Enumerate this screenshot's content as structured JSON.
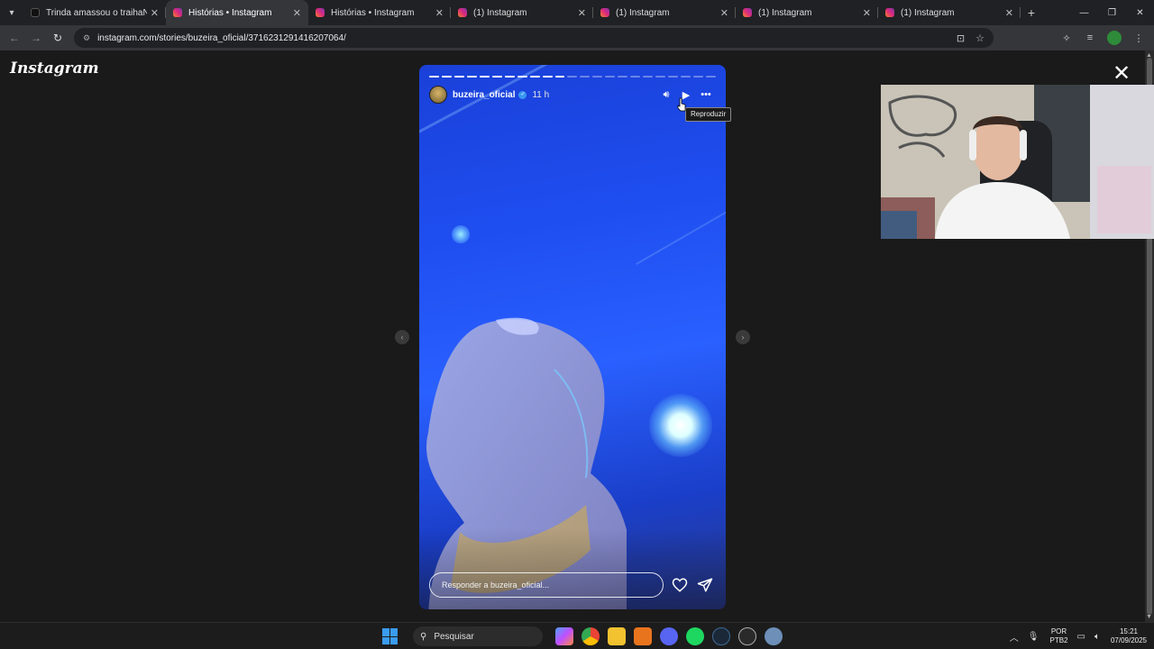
{
  "browser": {
    "tabs": [
      {
        "title": "Trinda amassou o traihaNs #m",
        "favicon": "tiktok",
        "active": false
      },
      {
        "title": "Histórias • Instagram",
        "favicon": "instagram",
        "active": true
      },
      {
        "title": "Histórias • Instagram",
        "favicon": "instagram",
        "active": false
      },
      {
        "title": "(1) Instagram",
        "favicon": "instagram",
        "active": false
      },
      {
        "title": "(1) Instagram",
        "favicon": "instagram",
        "active": false
      },
      {
        "title": "(1) Instagram",
        "favicon": "instagram",
        "active": false
      },
      {
        "title": "(1) Instagram",
        "favicon": "instagram",
        "active": false
      }
    ],
    "url": "instagram.com/stories/buzeira_oficial/3716231291416207064/"
  },
  "instagram": {
    "logo_text": "Instagram",
    "story": {
      "username": "buzeira_oficial",
      "verified": true,
      "time_ago": "11 h",
      "progress_segments": 23,
      "progress_completed": 11,
      "tooltip": "Reproduzir",
      "reply_placeholder": "Responder a buzeira_oficial..."
    }
  },
  "taskbar": {
    "search_placeholder": "Pesquisar",
    "language": "POR",
    "layout": "PTB2",
    "time": "15:21",
    "date": "07/09/2025"
  },
  "colors": {
    "accent_blue": "#2a60ff",
    "verified_blue": "#3897f0",
    "windows_blue": "#3a9bf0"
  }
}
